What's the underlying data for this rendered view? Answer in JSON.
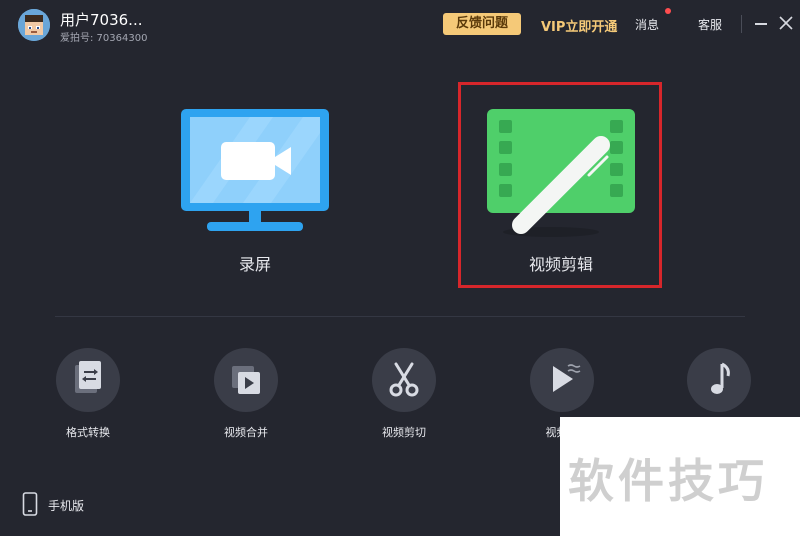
{
  "header": {
    "username": "用户7036...",
    "user_id": "爱拍号: 70364300",
    "feedback_label": "反馈问题",
    "vip_label": "VIP立即开通",
    "messages_label": "消息",
    "service_label": "客服"
  },
  "main_cards": [
    {
      "label": "录屏"
    },
    {
      "label": "视频剪辑"
    }
  ],
  "tools": [
    {
      "label": "格式转换",
      "icon": "format-convert-icon"
    },
    {
      "label": "视频合并",
      "icon": "video-merge-icon"
    },
    {
      "label": "视频剪切",
      "icon": "scissors-icon"
    },
    {
      "label": "视频加",
      "icon": "play-icon"
    },
    {
      "label": "",
      "icon": "music-note-icon"
    }
  ],
  "footer": {
    "mobile_label": "手机版"
  },
  "watermark": {
    "text": "软件技巧"
  },
  "colors": {
    "background": "#24262f",
    "accent_gold": "#f5c978",
    "screen_blue": "#2ea3f0",
    "edit_green": "#4fcf6a",
    "highlight_red": "#d7262b"
  }
}
